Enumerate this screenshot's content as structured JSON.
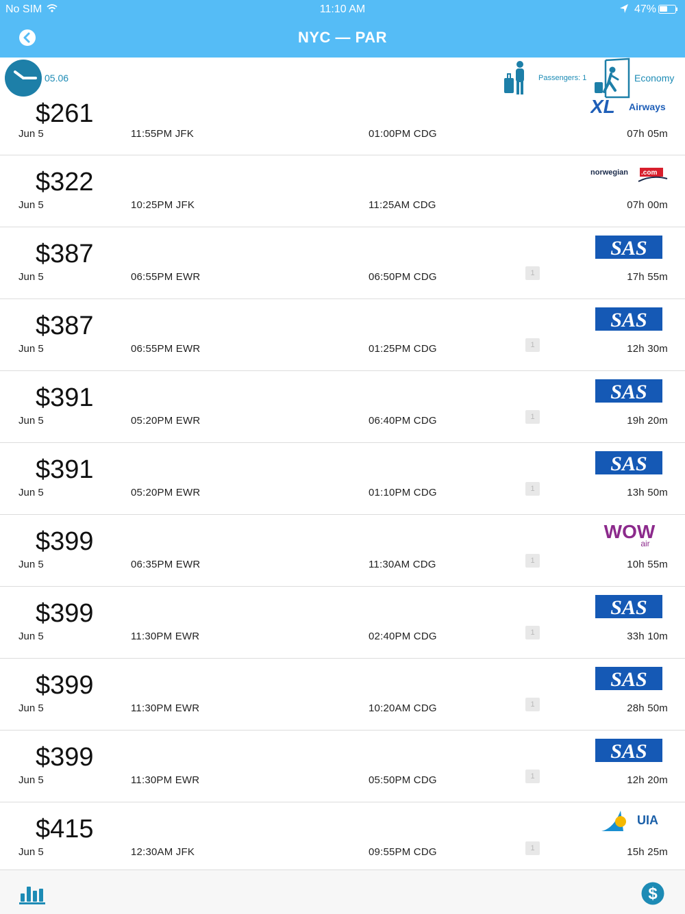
{
  "status_bar": {
    "carrier": "No SIM",
    "time": "11:10 AM",
    "battery": "47%",
    "icons": [
      "wifi-icon",
      "location-arrow-icon",
      "battery-icon"
    ]
  },
  "nav": {
    "title": "NYC — PAR",
    "back_icon": "back-chevron-icon"
  },
  "filters": {
    "date": "05.06",
    "passengers": "Passengers: 1",
    "cabin_class": "Economy"
  },
  "colors": {
    "header_blue": "#55bcf6",
    "accent_teal": "#1d8bb5",
    "sas_blue": "#1559b5",
    "wow_purple": "#8c2a8c",
    "norwegian_red": "#d81e2c"
  },
  "flights": [
    {
      "price": "$261",
      "date": "Jun 5",
      "depart": "11:55PM JFK",
      "arrive": "01:00PM CDG",
      "stops": "",
      "duration": "07h 05m",
      "airline": "XL Airways"
    },
    {
      "price": "$322",
      "date": "Jun 5",
      "depart": "10:25PM JFK",
      "arrive": "11:25AM CDG",
      "stops": "",
      "duration": "07h 00m",
      "airline": "norwegian.com"
    },
    {
      "price": "$387",
      "date": "Jun 5",
      "depart": "06:55PM EWR",
      "arrive": "06:50PM CDG",
      "stops": "1",
      "duration": "17h 55m",
      "airline": "SAS"
    },
    {
      "price": "$387",
      "date": "Jun 5",
      "depart": "06:55PM EWR",
      "arrive": "01:25PM CDG",
      "stops": "1",
      "duration": "12h 30m",
      "airline": "SAS"
    },
    {
      "price": "$391",
      "date": "Jun 5",
      "depart": "05:20PM EWR",
      "arrive": "06:40PM CDG",
      "stops": "1",
      "duration": "19h 20m",
      "airline": "SAS"
    },
    {
      "price": "$391",
      "date": "Jun 5",
      "depart": "05:20PM EWR",
      "arrive": "01:10PM CDG",
      "stops": "1",
      "duration": "13h 50m",
      "airline": "SAS"
    },
    {
      "price": "$399",
      "date": "Jun 5",
      "depart": "06:35PM EWR",
      "arrive": "11:30AM CDG",
      "stops": "1",
      "duration": "10h 55m",
      "airline": "WOW air"
    },
    {
      "price": "$399",
      "date": "Jun 5",
      "depart": "11:30PM EWR",
      "arrive": "02:40PM CDG",
      "stops": "1",
      "duration": "33h 10m",
      "airline": "SAS"
    },
    {
      "price": "$399",
      "date": "Jun 5",
      "depart": "11:30PM EWR",
      "arrive": "10:20AM CDG",
      "stops": "1",
      "duration": "28h 50m",
      "airline": "SAS"
    },
    {
      "price": "$399",
      "date": "Jun 5",
      "depart": "11:30PM EWR",
      "arrive": "05:50PM CDG",
      "stops": "1",
      "duration": "12h 20m",
      "airline": "SAS"
    },
    {
      "price": "$415",
      "date": "Jun 5",
      "depart": "12:30AM JFK",
      "arrive": "09:55PM CDG",
      "stops": "1",
      "duration": "15h 25m",
      "airline": "UIA"
    }
  ],
  "tab_bar": {
    "items": [
      "bar-chart-icon",
      "dollar-icon"
    ]
  }
}
